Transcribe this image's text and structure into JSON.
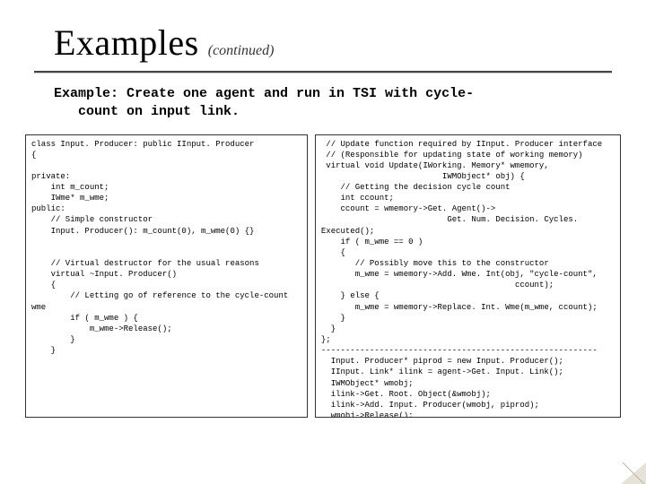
{
  "title": {
    "main": "Examples",
    "sub": "(continued)"
  },
  "subtitle": "Example: Create one agent and run in TSI with cycle-\n   count on input link.",
  "code_left": "class Input. Producer: public IInput. Producer\n{\n\nprivate:\n    int m_count;\n    IWme* m_wme;\npublic:\n    // Simple constructor\n    Input. Producer(): m_count(0), m_wme(0) {}\n\n\n    // Virtual destructor for the usual reasons\n    virtual ~Input. Producer()\n    {\n        // Letting go of reference to the cycle-count wme\n        if ( m_wme ) {\n            m_wme->Release();\n        }\n    }",
  "code_right": " // Update function required by IInput. Producer interface\n // (Responsible for updating state of working memory)\n virtual void Update(IWorking. Memory* wmemory,\n                         IWMObject* obj) {\n    // Getting the decision cycle count\n    int ccount;\n    ccount = wmemory->Get. Agent()->\n                          Get. Num. Decision. Cycles. Executed();\n    if ( m_wme == 0 )\n    {\n       // Possibly move this to the constructor\n       m_wme = wmemory->Add. Wme. Int(obj, \"cycle-count\",\n                                        ccount);\n    } else {\n       m_wme = wmemory->Replace. Int. Wme(m_wme, ccount);\n    }\n  }\n};\n---------------------------------------------------------\n  Input. Producer* piprod = new Input. Producer();\n  IInput. Link* ilink = agent->Get. Input. Link();\n  IWMObject* wmobj;\n  ilink->Get. Root. Object(&wmobj);\n  ilink->Add. Input. Producer(wmobj, piprod);\n  wmobj->Release();"
}
